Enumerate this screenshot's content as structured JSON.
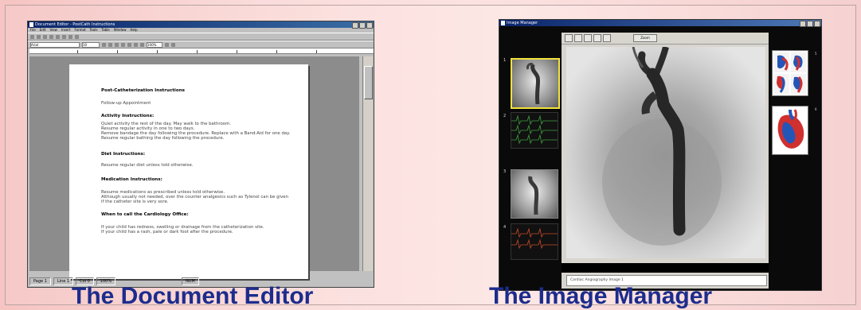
{
  "captions": {
    "left": "The Document Editor",
    "right": "The Image Manager"
  },
  "document_editor": {
    "title": "Document Editor - PostCath Instructions",
    "menu": [
      "File",
      "Edit",
      "View",
      "Insert",
      "Format",
      "Tools",
      "Table",
      "Window",
      "Help"
    ],
    "font_name": "Arial",
    "font_size": "10",
    "zoom": "100%",
    "page": {
      "heading": "Post-Catheterization Instructions",
      "line_followup": "Follow-up Appointment",
      "activity_heading": "Activity Instructions:",
      "activity_lines": [
        "Quiet activity the rest of the day. May walk to the bathroom.",
        "Resume regular activity in one to two days.",
        "Remove bandage the day following the procedure. Replace with a Band-Aid for one day.",
        "Resume regular bathing the day following the procedure."
      ],
      "diet_heading": "Diet Instructions:",
      "diet_line": "Resume regular diet unless told otherwise.",
      "medication_heading": "Medication Instructions:",
      "medication_lines": [
        "Resume medications as prescribed unless told otherwise.",
        "Although usually not needed, over the counter analgesics such as Tylenol can be given",
        "if the catheter site is very sore."
      ],
      "when_heading": "When to call the Cardiology Office:",
      "when_lines": [
        "If your child has redness, swelling or drainage from the catheterization site.",
        "If your child has a rash, pale or dark foot after the procedure."
      ]
    },
    "status": {
      "page": "Page 1",
      "line": "Line 1",
      "col": "Col 0",
      "zoom": "100%",
      "mode": "NUM"
    }
  },
  "image_manager": {
    "title": "Image Manager",
    "zoom_button": "Zoom",
    "thumb_numbers": [
      "1",
      "2",
      "3",
      "4"
    ],
    "right_numbers": [
      "5",
      "6"
    ],
    "notes_placeholder": "Cardiac Angiography Image 1"
  },
  "colors": {
    "caption": "#1c2c8c",
    "selected_thumb": "#f2e23a",
    "titlebar": "#0a246a"
  }
}
